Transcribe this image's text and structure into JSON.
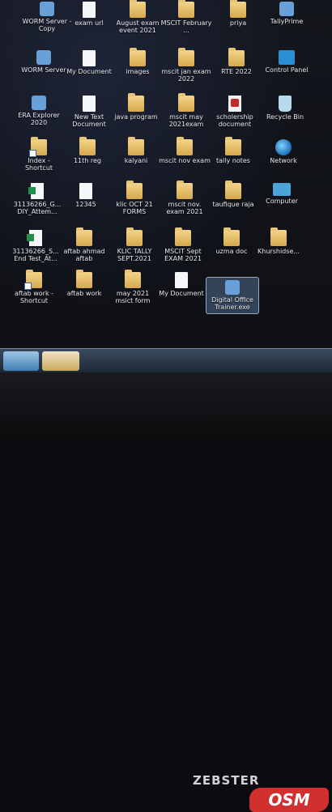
{
  "icons": [
    {
      "label": "WORM Server - Copy",
      "type": "app"
    },
    {
      "label": "exam url",
      "type": "doc"
    },
    {
      "label": "August exam event 2021",
      "type": "folder"
    },
    {
      "label": "MSCIT February ...",
      "type": "folder"
    },
    {
      "label": "priya",
      "type": "folder"
    },
    {
      "label": "TallyPrime",
      "type": "app"
    },
    {
      "label": "WORM Server",
      "type": "app"
    },
    {
      "label": "My Document",
      "type": "doc"
    },
    {
      "label": "images",
      "type": "folder"
    },
    {
      "label": "mscit jan exam 2022",
      "type": "folder"
    },
    {
      "label": "RTE 2022",
      "type": "folder"
    },
    {
      "label": "Control Panel",
      "type": "cp"
    },
    {
      "label": "ERA Explorer 2020",
      "type": "app"
    },
    {
      "label": "New Text Document",
      "type": "doc"
    },
    {
      "label": "java program",
      "type": "folder"
    },
    {
      "label": "mscit may 2021exam",
      "type": "folder"
    },
    {
      "label": "scholership document",
      "type": "pdf"
    },
    {
      "label": "Recycle Bin",
      "type": "bin"
    },
    {
      "label": "Index - Shortcut",
      "type": "folder"
    },
    {
      "label": "11th reg",
      "type": "folder"
    },
    {
      "label": "kalyani",
      "type": "folder"
    },
    {
      "label": "mscit nov exam",
      "type": "folder"
    },
    {
      "label": "tally notes",
      "type": "folder"
    },
    {
      "label": "Network",
      "type": "globe"
    },
    {
      "label": "31136266_G... DIY_Attem...",
      "type": "excel"
    },
    {
      "label": "12345",
      "type": "doc"
    },
    {
      "label": "klic OCT 21 FORMS",
      "type": "folder"
    },
    {
      "label": "mscit nov. exam 2021",
      "type": "folder"
    },
    {
      "label": "taufique raja",
      "type": "folder"
    },
    {
      "label": "Computer",
      "type": "pc"
    },
    {
      "label": "31136266_S... End Test_At...",
      "type": "excel"
    },
    {
      "label": "aftab ahmad aftab",
      "type": "folder"
    },
    {
      "label": "KLIC TALLY SEPT.2021",
      "type": "folder"
    },
    {
      "label": "MSCIT Sept EXAM 2021",
      "type": "folder"
    },
    {
      "label": "uzma doc",
      "type": "folder"
    },
    {
      "label": "Khurshidse...",
      "type": "folder"
    },
    {
      "label": "aftab work - Shortcut",
      "type": "folder"
    },
    {
      "label": "aftab work",
      "type": "folder"
    },
    {
      "label": "may 2021 msict form",
      "type": "folder"
    },
    {
      "label": "My Document",
      "type": "doc"
    },
    {
      "label": "Digital Office Trainer.exe",
      "type": "app"
    }
  ],
  "taskbar": {
    "start": "",
    "pinned": ""
  },
  "monitor": {
    "brand": "ZEBSTER"
  },
  "watermark": {
    "text": "OSM"
  },
  "colors": {
    "desktop": "#101218",
    "folder": "#e2bb66",
    "taskbar": "#2b3a4d",
    "watermark": "#d22f2f"
  }
}
